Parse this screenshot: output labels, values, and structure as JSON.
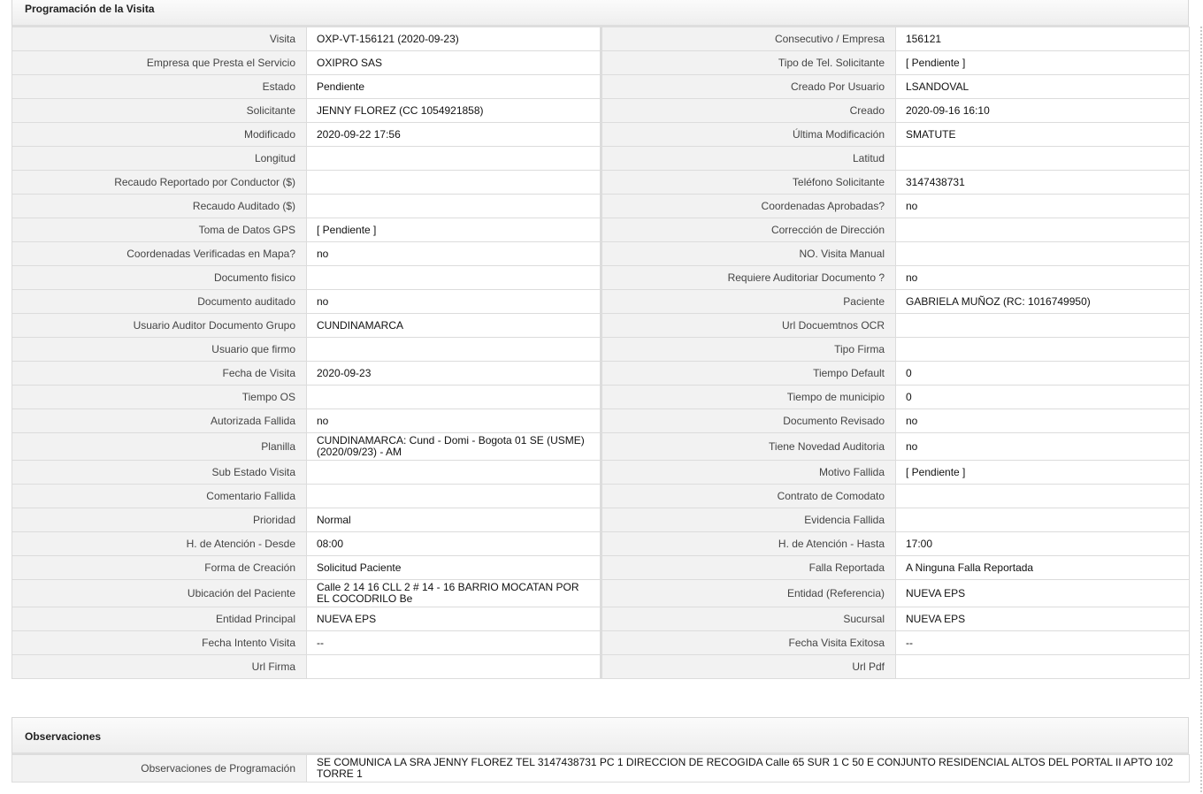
{
  "programacion": {
    "title": "Programación de la Visita",
    "rows": [
      {
        "l1": "Visita",
        "v1": "OXP-VT-156121 (2020-09-23)",
        "l2": "Consecutivo / Empresa",
        "v2": "156121"
      },
      {
        "l1": "Empresa que Presta el Servicio",
        "v1": "OXIPRO SAS",
        "l2": "Tipo de Tel. Solicitante",
        "v2": "[ Pendiente ]"
      },
      {
        "l1": "Estado",
        "v1": "Pendiente",
        "l2": "Creado Por Usuario",
        "v2": "LSANDOVAL"
      },
      {
        "l1": "Solicitante",
        "v1": "JENNY FLOREZ (CC 1054921858)",
        "l2": "Creado",
        "v2": "2020-09-16 16:10"
      },
      {
        "l1": "Modificado",
        "v1": "2020-09-22 17:56",
        "l2": "Última Modificación",
        "v2": " SMATUTE"
      },
      {
        "l1": "Longitud",
        "v1": "",
        "l2": "Latitud",
        "v2": ""
      },
      {
        "l1": "Recaudo Reportado por Conductor ($)",
        "v1": "",
        "l2": "Teléfono Solicitante",
        "v2": "3147438731"
      },
      {
        "l1": "Recaudo Auditado ($)",
        "v1": "",
        "l2": "Coordenadas Aprobadas?",
        "v2": " no"
      },
      {
        "l1": "Toma de Datos GPS",
        "v1": "[ Pendiente ]",
        "l2": "Corrección de Dirección",
        "v2": ""
      },
      {
        "l1": "Coordenadas Verificadas en Mapa?",
        "v1": " no",
        "l2": "NO. Visita Manual",
        "v2": ""
      },
      {
        "l1": "Documento fisico",
        "v1": "",
        "l2": "Requiere Auditoriar Documento ?",
        "v2": " no"
      },
      {
        "l1": "Documento auditado",
        "v1": " no",
        "l2": "Paciente",
        "v2": "GABRIELA MUÑOZ (RC: 1016749950)"
      },
      {
        "l1": "Usuario Auditor Documento Grupo",
        "v1": "CUNDINAMARCA",
        "l2": "Url Docuemtnos OCR",
        "v2": ""
      },
      {
        "l1": "Usuario que firmo",
        "v1": "",
        "l2": "Tipo Firma",
        "v2": ""
      },
      {
        "l1": "Fecha de Visita",
        "v1": " 2020-09-23",
        "l2": "Tiempo Default",
        "v2": "0"
      },
      {
        "l1": "Tiempo OS",
        "v1": "",
        "l2": "Tiempo de municipio",
        "v2": "0"
      },
      {
        "l1": "Autorizada Fallida",
        "v1": " no",
        "l2": "Documento Revisado",
        "v2": " no"
      },
      {
        "l1": "Planilla",
        "v1": "CUNDINAMARCA: Cund - Domi - Bogota 01 SE (USME) (2020/09/23) - AM",
        "l2": "Tiene Novedad Auditoria",
        "v2": " no"
      },
      {
        "l1": "Sub Estado Visita",
        "v1": "",
        "l2": "Motivo Fallida",
        "v2": "[ Pendiente ]"
      },
      {
        "l1": "Comentario Fallida",
        "v1": "",
        "l2": "Contrato de Comodato",
        "v2": ""
      },
      {
        "l1": "Prioridad",
        "v1": "Normal",
        "l2": "Evidencia Fallida",
        "v2": ""
      },
      {
        "l1": "H. de Atención - Desde",
        "v1": "08:00",
        "l2": "H. de Atención - Hasta",
        "v2": "17:00"
      },
      {
        "l1": "Forma de Creación",
        "v1": "Solicitud Paciente",
        "l2": "Falla Reportada",
        "v2": "A Ninguna Falla Reportada"
      },
      {
        "l1": "Ubicación del Paciente",
        "v1": "Calle 2 14 16 CLL 2 # 14 - 16 BARRIO MOCATAN POR EL COCODRILO Be",
        "l2": "Entidad (Referencia)",
        "v2": "NUEVA EPS"
      },
      {
        "l1": "Entidad Principal",
        "v1": "NUEVA EPS",
        "l2": "Sucursal",
        "v2": "NUEVA EPS"
      },
      {
        "l1": "Fecha Intento Visita",
        "v1": " --",
        "l2": "Fecha Visita Exitosa",
        "v2": " --"
      },
      {
        "l1": "Url Firma",
        "v1": "",
        "l2": "Url Pdf",
        "v2": ""
      }
    ]
  },
  "observaciones": {
    "title": "Observaciones",
    "label": "Observaciones de Programación",
    "value": "  SE COMUNICA LA SRA JENNY FLOREZ TEL 3147438731 PC 1 DIRECCION DE RECOGIDA Calle 65 SUR 1 C 50 E CONJUNTO RESIDENCIAL ALTOS DEL PORTAL II APTO 102 TORRE 1"
  }
}
